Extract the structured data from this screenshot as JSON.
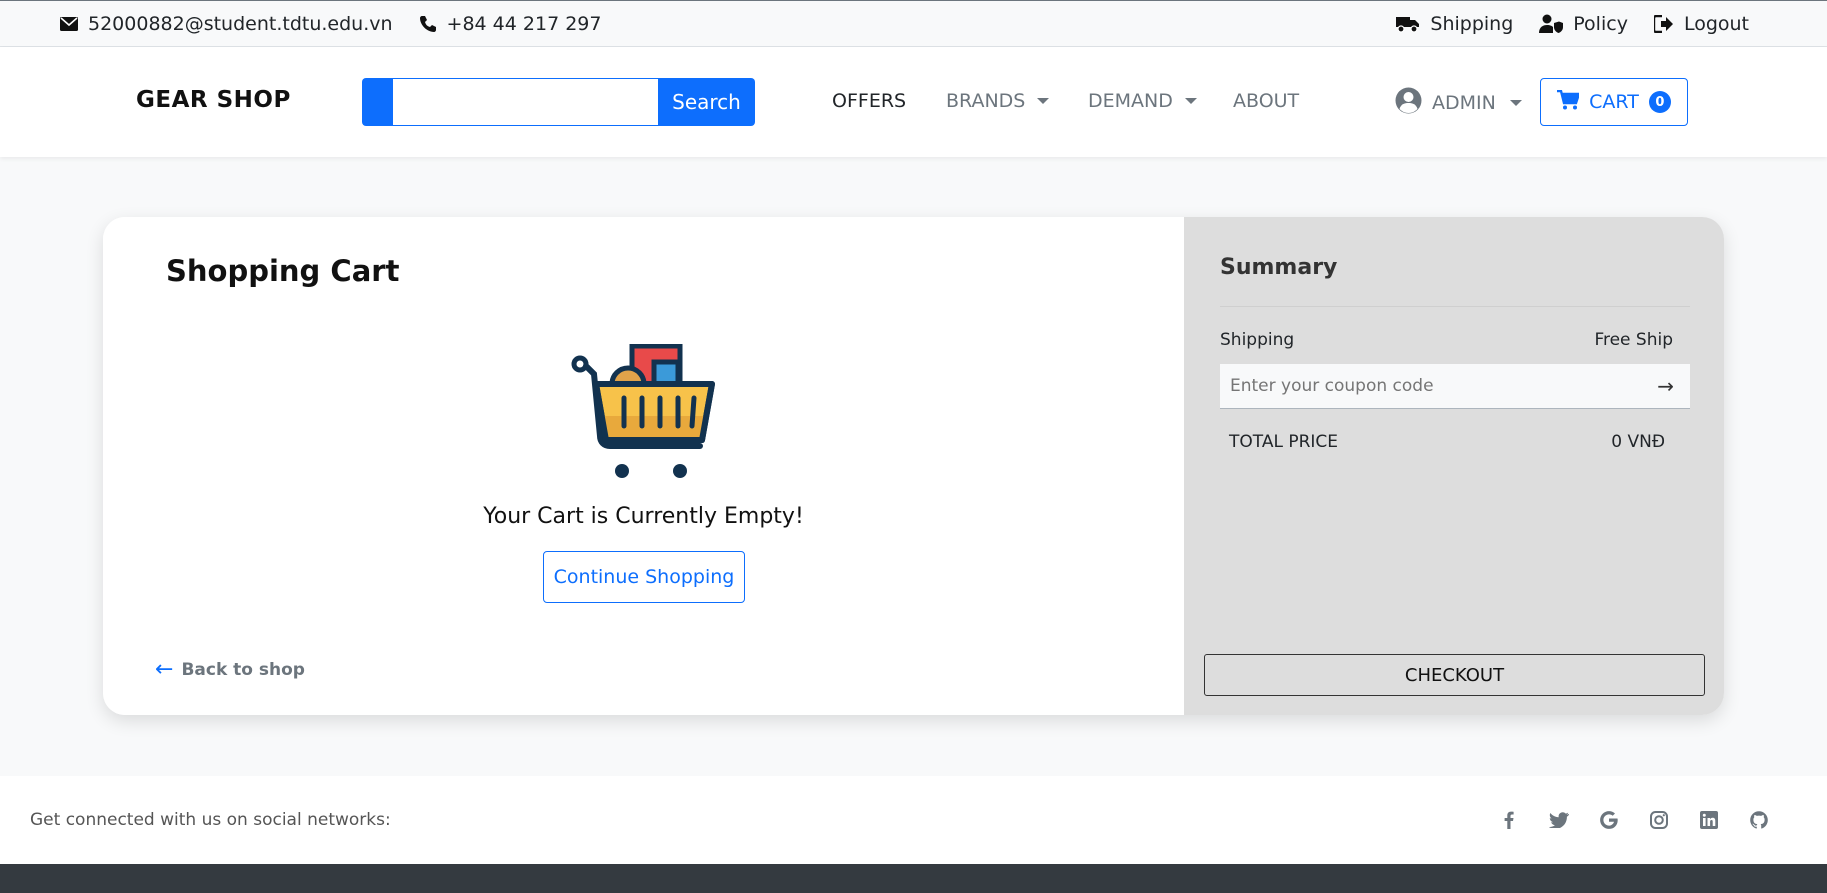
{
  "topbar": {
    "email": "52000882@student.tdtu.edu.vn",
    "phone": "+84 44 217 297",
    "shipping": "Shipping",
    "policy": "Policy",
    "logout": "Logout"
  },
  "navbar": {
    "brand": "GEAR SHOP",
    "search_value": "",
    "search_label": "Search",
    "links": {
      "offers": "OFFERS",
      "brands": "BRANDS",
      "demand": "DEMAND",
      "about": "ABOUT"
    },
    "user": "ADMIN",
    "cart_label": "CART",
    "cart_count": "0"
  },
  "cart": {
    "title": "Shopping Cart",
    "empty_message": "Your Cart is Currently Empty!",
    "continue_label": "Continue Shopping",
    "back_arrow": "←",
    "back_label": "Back to shop"
  },
  "summary": {
    "title": "Summary",
    "shipping_label": "Shipping",
    "shipping_value": "Free Ship",
    "coupon_placeholder": "Enter your coupon code",
    "coupon_submit": "→",
    "total_label": "TOTAL PRICE",
    "total_value": "0 VNĐ",
    "checkout_label": "CHECKOUT"
  },
  "footer": {
    "social_text": "Get connected with us on social networks:",
    "icons": [
      "facebook-icon",
      "twitter-icon",
      "google-icon",
      "instagram-icon",
      "linkedin-icon",
      "github-icon"
    ]
  },
  "colors": {
    "primary": "#0d6efd",
    "summary_bg": "#dddddd",
    "page_bg": "#f8f9fa",
    "footer_dark": "#343a40"
  }
}
